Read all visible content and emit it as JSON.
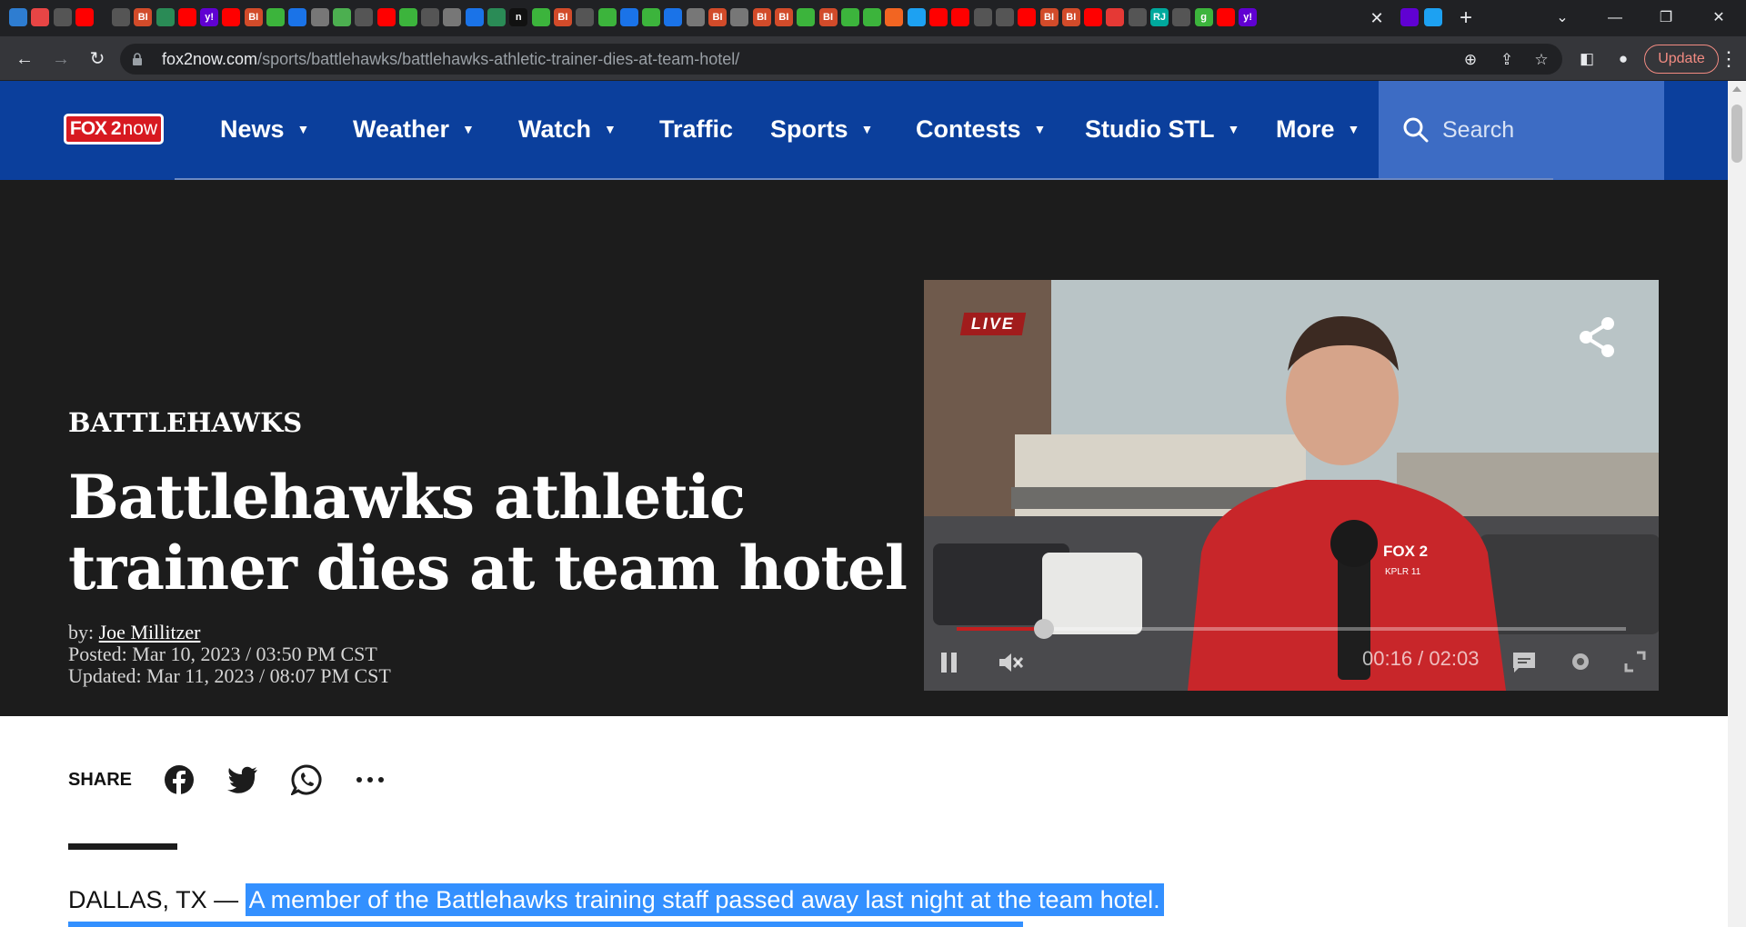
{
  "browser": {
    "url_host": "fox2now.com",
    "url_path": "/sports/battlehawks/battlehawks-athletic-trainer-dies-at-team-hotel/",
    "update_label": "Update",
    "tab_icons": [
      {
        "label": "",
        "color": "#2e7dd1",
        "icon": "globe-icon"
      },
      {
        "label": "",
        "color": "#e84545",
        "icon": "app-icon"
      },
      {
        "label": "",
        "color": "#555555",
        "icon": "globe-icon"
      },
      {
        "label": "",
        "color": "#ff0000",
        "icon": "youtube-icon"
      },
      {
        "label": "",
        "color": "#555555",
        "icon": "globe-icon"
      },
      {
        "label": "BI",
        "color": "#d24b2a",
        "icon": "bi-icon"
      },
      {
        "label": "",
        "color": "#2a8b56",
        "icon": "globe-icon"
      },
      {
        "label": "",
        "color": "#ff0000",
        "icon": "youtube-icon"
      },
      {
        "label": "y!",
        "color": "#6001d2",
        "icon": "yahoo-icon"
      },
      {
        "label": "",
        "color": "#ff0000",
        "icon": "youtube-icon"
      },
      {
        "label": "BI",
        "color": "#d24b2a",
        "icon": "bi-icon"
      },
      {
        "label": "",
        "color": "#3cb43c",
        "icon": "play-icon"
      },
      {
        "label": "",
        "color": "#1a73e8",
        "icon": "shield-icon"
      },
      {
        "label": "",
        "color": "#777777",
        "icon": "play-icon"
      },
      {
        "label": "",
        "color": "#4caf50",
        "icon": "grid-icon"
      },
      {
        "label": "",
        "color": "#555555",
        "icon": "globe-icon"
      },
      {
        "label": "",
        "color": "#ff0000",
        "icon": "youtube-icon"
      },
      {
        "label": "",
        "color": "#3cb43c",
        "icon": "play-icon"
      },
      {
        "label": "",
        "color": "#555555",
        "icon": "globe-icon"
      },
      {
        "label": "",
        "color": "#777777",
        "icon": "play-icon"
      },
      {
        "label": "",
        "color": "#1a73e8",
        "icon": "search-icon"
      },
      {
        "label": "",
        "color": "#2a8b56",
        "icon": "globe-icon"
      },
      {
        "label": "n",
        "color": "#111111",
        "icon": "n-icon"
      },
      {
        "label": "",
        "color": "#3cb43c",
        "icon": "play-icon"
      },
      {
        "label": "BI",
        "color": "#d24b2a",
        "icon": "bi-icon"
      },
      {
        "label": "",
        "color": "#555555",
        "icon": "globe-icon"
      },
      {
        "label": "",
        "color": "#3cb43c",
        "icon": "play-icon"
      },
      {
        "label": "",
        "color": "#1a73e8",
        "icon": "shield-icon"
      },
      {
        "label": "",
        "color": "#3cb43c",
        "icon": "play-icon"
      },
      {
        "label": "",
        "color": "#1a73e8",
        "icon": "search-icon"
      },
      {
        "label": "",
        "color": "#777777",
        "icon": "play-icon"
      },
      {
        "label": "BI",
        "color": "#d24b2a",
        "icon": "bi-icon"
      },
      {
        "label": "",
        "color": "#777777",
        "icon": "doc-icon"
      },
      {
        "label": "BI",
        "color": "#d24b2a",
        "icon": "bi-icon"
      },
      {
        "label": "BI",
        "color": "#d24b2a",
        "icon": "bi-icon"
      },
      {
        "label": "",
        "color": "#3cb43c",
        "icon": "play-icon"
      },
      {
        "label": "BI",
        "color": "#d24b2a",
        "icon": "bi-icon"
      },
      {
        "label": "",
        "color": "#3cb43c",
        "icon": "play-icon"
      },
      {
        "label": "",
        "color": "#3cb43c",
        "icon": "play-icon"
      },
      {
        "label": "",
        "color": "#f26522",
        "icon": "bookmark-icon"
      },
      {
        "label": "",
        "color": "#1da1f2",
        "icon": "twitter-icon"
      },
      {
        "label": "",
        "color": "#ff0000",
        "icon": "youtube-icon"
      },
      {
        "label": "",
        "color": "#ff0000",
        "icon": "youtube-icon"
      },
      {
        "label": "",
        "color": "#555555",
        "icon": "globe-icon"
      },
      {
        "label": "",
        "color": "#555555",
        "icon": "globe-icon"
      },
      {
        "label": "",
        "color": "#ff0000",
        "icon": "youtube-icon"
      },
      {
        "label": "BI",
        "color": "#d24b2a",
        "icon": "bi-icon"
      },
      {
        "label": "BI",
        "color": "#d24b2a",
        "icon": "bi-icon"
      },
      {
        "label": "",
        "color": "#ff0000",
        "icon": "youtube-icon"
      },
      {
        "label": "",
        "color": "#e53935",
        "icon": "app-icon"
      },
      {
        "label": "",
        "color": "#555555",
        "icon": "globe-icon"
      },
      {
        "label": "RJ",
        "color": "#00a99d",
        "icon": "rj-icon"
      },
      {
        "label": "",
        "color": "#555555",
        "icon": "globe-icon"
      },
      {
        "label": "g",
        "color": "#3cb43c",
        "icon": "g-icon"
      },
      {
        "label": "",
        "color": "#ff0000",
        "icon": "youtube-icon"
      },
      {
        "label": "y!",
        "color": "#6001d2",
        "icon": "yahoo-icon"
      }
    ],
    "active_tab_icons": [
      {
        "label": "",
        "color": "#6001d2",
        "icon": "yahoo-mail-icon"
      },
      {
        "label": "",
        "color": "#1da1f2",
        "icon": "twitter-icon"
      }
    ]
  },
  "site": {
    "logo_fox": "FOX 2",
    "logo_now": "now",
    "nav": [
      {
        "label": "News",
        "dropdown": true
      },
      {
        "label": "Weather",
        "dropdown": true
      },
      {
        "label": "Watch",
        "dropdown": true
      },
      {
        "label": "Traffic",
        "dropdown": false
      },
      {
        "label": "Sports",
        "dropdown": true
      },
      {
        "label": "Contests",
        "dropdown": true
      },
      {
        "label": "Studio STL",
        "dropdown": true
      },
      {
        "label": "More",
        "dropdown": true
      }
    ],
    "caret": "▼",
    "search_placeholder": "Search",
    "brand_blue": "#0b3f9c"
  },
  "article": {
    "kicker": "BATTLEHAWKS",
    "headline": "Battlehawks athletic trainer dies at team hotel",
    "by_prefix": "by: ",
    "author": "Joe Millitzer",
    "posted": "Posted: Mar 10, 2023 / 03:50 PM CST",
    "updated": "Updated: Mar 11, 2023 / 08:07 PM CST",
    "share_label": "SHARE",
    "dateline": "DALLAS, TX — ",
    "lead_highlighted": "A member of the Battlehawks training staff passed away last night at the team hotel."
  },
  "video": {
    "live_label": "LIVE",
    "time_display": "00:16 / 02:03",
    "progress": 0.13,
    "muted": true,
    "playing": true,
    "overlay_text": [
      "FOX 2",
      "KPLR 11"
    ]
  }
}
